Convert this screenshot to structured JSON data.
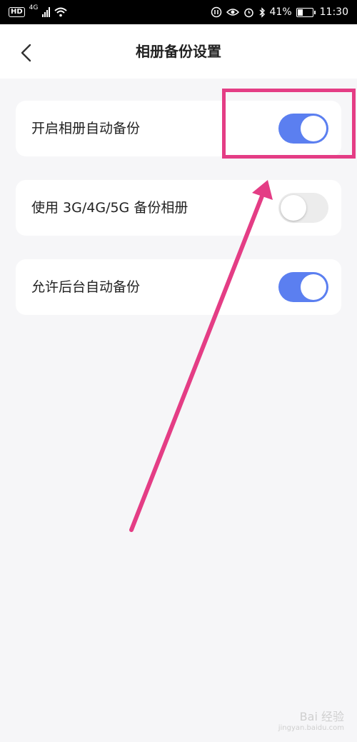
{
  "status_bar": {
    "hd": "HD",
    "network": "4G",
    "battery_percent": "41%",
    "battery_level": 0.41,
    "time": "11:30"
  },
  "nav": {
    "title": "相册备份设置"
  },
  "settings": [
    {
      "label": "开启相册自动备份",
      "enabled": true
    },
    {
      "label": "使用 3G/4G/5G 备份相册",
      "enabled": false
    },
    {
      "label": "允许后台自动备份",
      "enabled": true
    }
  ],
  "colors": {
    "toggle_on": "#5b7ff0",
    "toggle_off": "#ececec",
    "annotation": "#e43d85"
  },
  "watermark": {
    "brand": "Bai 经验",
    "url": "jingyan.baidu.com"
  }
}
